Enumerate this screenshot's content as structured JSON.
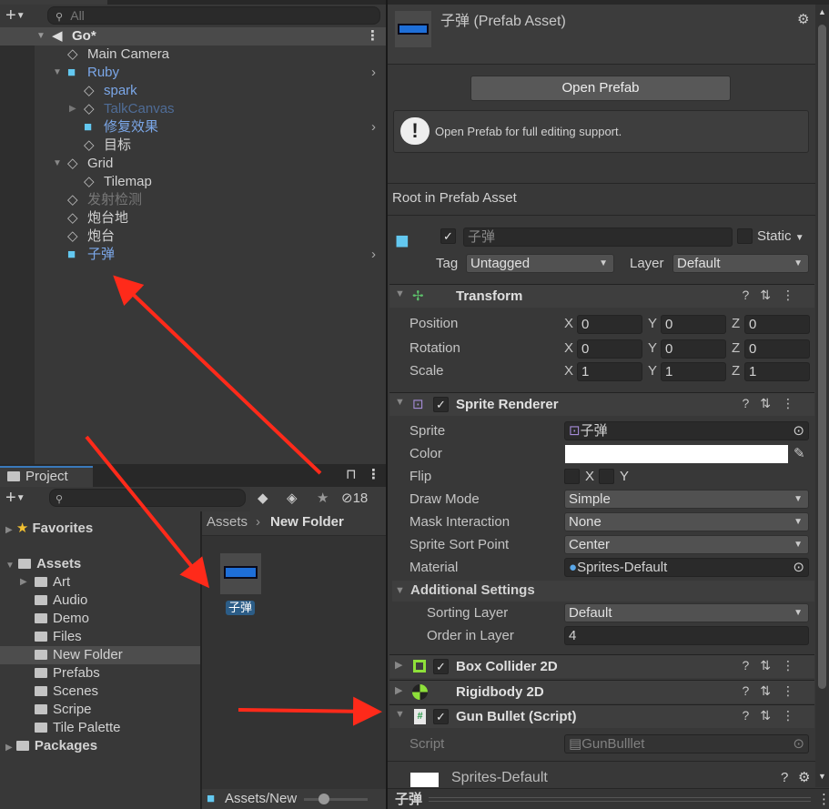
{
  "hierarchy": {
    "search_placeholder": "All",
    "scene": "Go*",
    "items": [
      {
        "label": "Main Camera",
        "color": "#d2d2d2",
        "indent": 0,
        "prefab": false
      },
      {
        "label": "Ruby",
        "color": "#7ba7e8",
        "indent": 0,
        "prefab": true,
        "expanded": true,
        "arrow": true
      },
      {
        "label": "spark",
        "color": "#7ba7e8",
        "indent": 1,
        "prefab": false
      },
      {
        "label": "TalkCanvas",
        "color": "#4f6c96",
        "indent": 1,
        "prefab": false,
        "collapsed": true
      },
      {
        "label": "修复效果",
        "color": "#7ba7e8",
        "indent": 1,
        "prefab": true,
        "arrow": true
      },
      {
        "label": "目标",
        "color": "#d2d2d2",
        "indent": 1,
        "prefab": false
      },
      {
        "label": "Grid",
        "color": "#d2d2d2",
        "indent": 0,
        "prefab": false,
        "expanded": true
      },
      {
        "label": "Tilemap",
        "color": "#d2d2d2",
        "indent": 1,
        "prefab": false
      },
      {
        "label": "发射检测",
        "color": "#777777",
        "indent": 0,
        "prefab": false
      },
      {
        "label": "炮台地",
        "color": "#d2d2d2",
        "indent": 0,
        "prefab": false
      },
      {
        "label": "炮台",
        "color": "#d2d2d2",
        "indent": 0,
        "prefab": false
      },
      {
        "label": "子弹",
        "color": "#7ba7e8",
        "indent": 0,
        "prefab": true,
        "arrow": true
      }
    ]
  },
  "project": {
    "tab": "Project",
    "hidden_count": "18",
    "favorites": "Favorites",
    "assets": "Assets",
    "folders": [
      "Art",
      "Audio",
      "Demo",
      "Files",
      "New Folder",
      "Prefabs",
      "Scenes",
      "Scripe",
      "Tile Palette"
    ],
    "selected_folder": "New Folder",
    "packages": "Packages",
    "breadcrumb": [
      "Assets",
      "New Folder"
    ],
    "asset_item": "子弹",
    "footer_path": "Assets/New"
  },
  "inspector": {
    "title": "子弹 (Prefab Asset)",
    "open_prefab": "Open Prefab",
    "help_text": "Open Prefab for full editing support.",
    "root_label": "Root in Prefab Asset",
    "object_name": "子弹",
    "static_label": "Static",
    "tag_label": "Tag",
    "tag_value": "Untagged",
    "layer_label": "Layer",
    "layer_value": "Default",
    "transform": {
      "title": "Transform",
      "rows": [
        {
          "label": "Position",
          "x": "0",
          "y": "0",
          "z": "0"
        },
        {
          "label": "Rotation",
          "x": "0",
          "y": "0",
          "z": "0"
        },
        {
          "label": "Scale",
          "x": "1",
          "y": "1",
          "z": "1"
        }
      ]
    },
    "sprite_renderer": {
      "title": "Sprite Renderer",
      "sprite_label": "Sprite",
      "sprite_value": "子弹",
      "color_label": "Color",
      "color_value": "#ffffff",
      "flip_label": "Flip",
      "flip_x": "X",
      "flip_y": "Y",
      "draw_mode_label": "Draw Mode",
      "draw_mode": "Simple",
      "mask_label": "Mask Interaction",
      "mask": "None",
      "sort_point_label": "Sprite Sort Point",
      "sort_point": "Center",
      "material_label": "Material",
      "material": "Sprites-Default",
      "additional": "Additional Settings",
      "sorting_layer_label": "Sorting Layer",
      "sorting_layer": "Default",
      "order_label": "Order in Layer",
      "order": "4"
    },
    "box_collider": "Box Collider 2D",
    "rigidbody": "Rigidbody 2D",
    "script_component": {
      "title": "Gun Bullet (Script)",
      "script_label": "Script",
      "script_value": "GunBulllet"
    },
    "material_preview": "Sprites-Default",
    "footer_name": "子弹"
  },
  "colors": {
    "accent": "#1e6fd9",
    "annotation_arrow": "#ff2a1a",
    "prefab_blue": "#7ba7e8"
  }
}
